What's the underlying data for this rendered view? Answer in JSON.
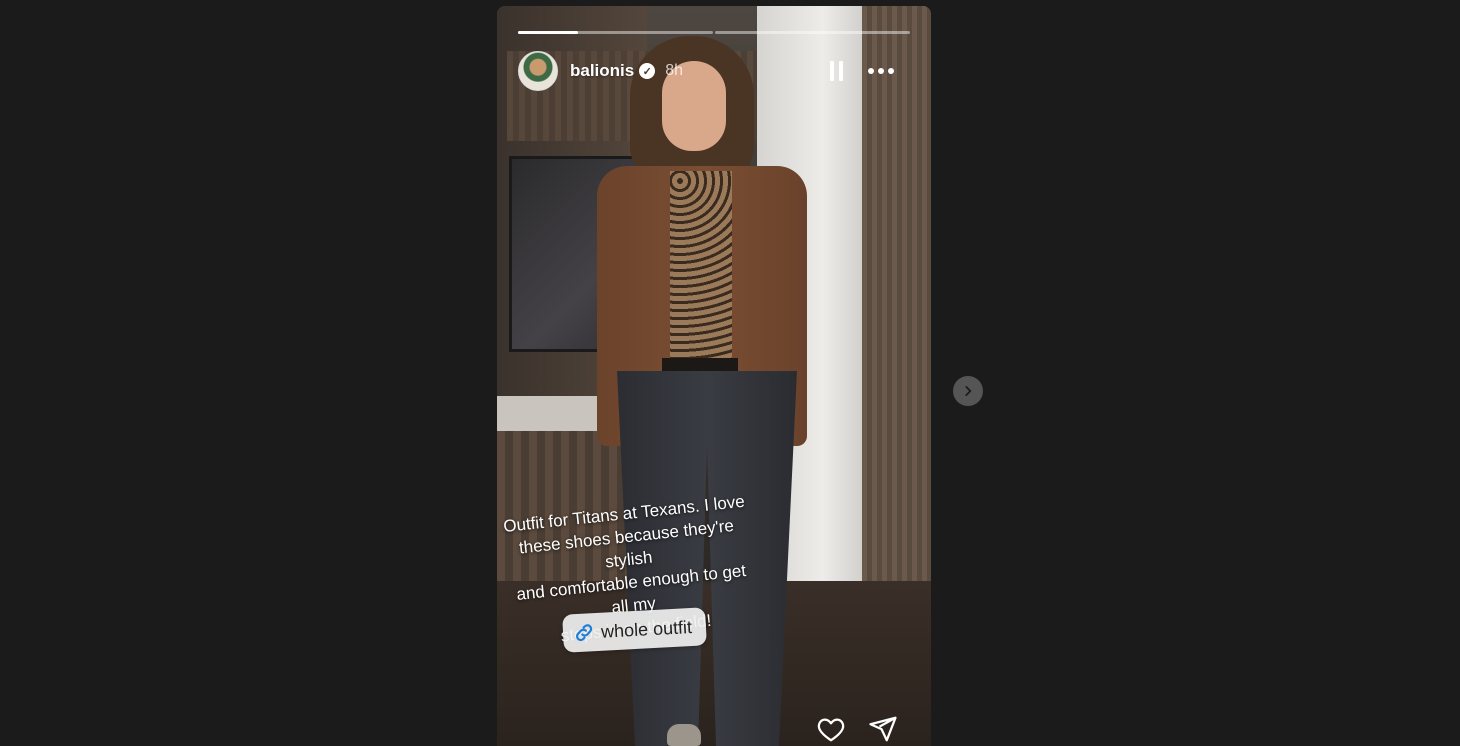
{
  "story": {
    "progress": {
      "segments": 2,
      "current_segment": 1,
      "current_segment_progress": 0.31
    },
    "header": {
      "username": "balionis",
      "verified": true,
      "time_ago": "8h",
      "icons": {
        "avatar": "profile-avatar",
        "verified": "verified-badge-icon",
        "pause": "pause-icon",
        "more": "more-options-icon"
      }
    },
    "caption": {
      "line1": "Outfit for Titans at Texans. I love",
      "line2": "these shoes because they're stylish",
      "line3": "and comfortable enough to get all my",
      "line4": "steps in on the field!"
    },
    "link_sticker": {
      "label": "whole outfit",
      "icon": "link-icon"
    },
    "footer": {
      "like_icon": "heart-icon",
      "share_icon": "send-icon"
    }
  },
  "navigation": {
    "next_icon": "chevron-right-icon"
  },
  "colors": {
    "page_background": "#1b1b1b",
    "link_icon": "#1e7fd8",
    "next_button": "#555555"
  }
}
